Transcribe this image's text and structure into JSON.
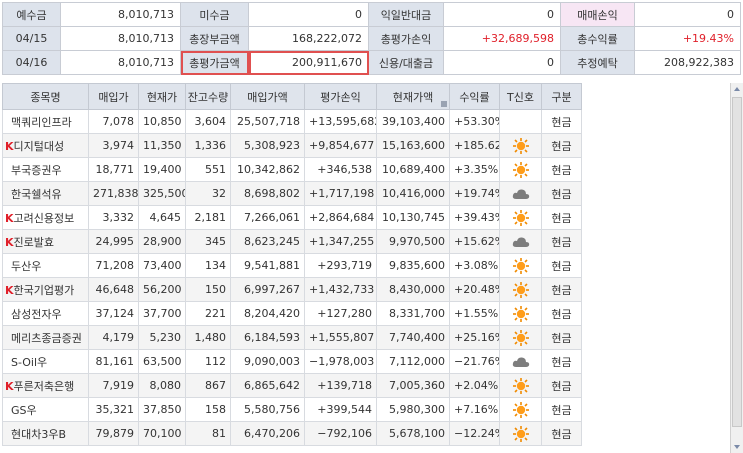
{
  "summary": {
    "row1": {
      "l1": "예수금",
      "v1": "8,010,713",
      "l2": "미수금",
      "v2": "0",
      "l3": "익일반대금",
      "v3": "0",
      "l4": "매매손익",
      "v4": "0"
    },
    "row2": {
      "l1": "04/15",
      "v1": "8,010,713",
      "l2": "총장부금액",
      "v2": "168,222,072",
      "l3": "총평가손익",
      "v3": "+32,689,598",
      "l4": "총수익률",
      "v4": "+19.43%"
    },
    "row3": {
      "l1": "04/16",
      "v1": "8,010,713",
      "l2": "총평가금액",
      "v2": "200,911,670",
      "l3": "신용/대출금",
      "v3": "0",
      "l4": "추정예탁",
      "v4": "208,922,383"
    }
  },
  "columns": [
    "종목명",
    "매입가",
    "현재가",
    "잔고수량",
    "매입가액",
    "평가손익",
    "현재가액",
    "수익률",
    "T신호",
    "구분"
  ],
  "rows": [
    {
      "k": "",
      "name": "맥쿼리인프라",
      "buy": "7,078",
      "cur": "10,850",
      "qty": "3,604",
      "buyamt": "25,507,718",
      "pl": "+13,595,682",
      "curamt": "39,103,400",
      "rate": "+53.30%",
      "signal": "",
      "type": "현금"
    },
    {
      "k": "K",
      "name": "디지털대성",
      "buy": "3,974",
      "cur": "11,350",
      "qty": "1,336",
      "buyamt": "5,308,923",
      "pl": "+9,854,677",
      "curamt": "15,163,600",
      "rate": "+185.62%",
      "signal": "sun",
      "type": "현금"
    },
    {
      "k": "",
      "name": "부국증권우",
      "buy": "18,771",
      "cur": "19,400",
      "qty": "551",
      "buyamt": "10,342,862",
      "pl": "+346,538",
      "curamt": "10,689,400",
      "rate": "+3.35%",
      "signal": "sun",
      "type": "현금"
    },
    {
      "k": "",
      "name": "한국쉘석유",
      "buy": "271,838",
      "cur": "325,500",
      "qty": "32",
      "buyamt": "8,698,802",
      "pl": "+1,717,198",
      "curamt": "10,416,000",
      "rate": "+19.74%",
      "signal": "cloud",
      "type": "현금"
    },
    {
      "k": "K",
      "name": "고려신용정보",
      "buy": "3,332",
      "cur": "4,645",
      "qty": "2,181",
      "buyamt": "7,266,061",
      "pl": "+2,864,684",
      "curamt": "10,130,745",
      "rate": "+39.43%",
      "signal": "sun",
      "type": "현금"
    },
    {
      "k": "K",
      "name": "진로발효",
      "buy": "24,995",
      "cur": "28,900",
      "qty": "345",
      "buyamt": "8,623,245",
      "pl": "+1,347,255",
      "curamt": "9,970,500",
      "rate": "+15.62%",
      "signal": "cloud",
      "type": "현금"
    },
    {
      "k": "",
      "name": "두산우",
      "buy": "71,208",
      "cur": "73,400",
      "qty": "134",
      "buyamt": "9,541,881",
      "pl": "+293,719",
      "curamt": "9,835,600",
      "rate": "+3.08%",
      "signal": "sun",
      "type": "현금"
    },
    {
      "k": "K",
      "name": "한국기업평가",
      "buy": "46,648",
      "cur": "56,200",
      "qty": "150",
      "buyamt": "6,997,267",
      "pl": "+1,432,733",
      "curamt": "8,430,000",
      "rate": "+20.48%",
      "signal": "sun",
      "type": "현금"
    },
    {
      "k": "",
      "name": "삼성전자우",
      "buy": "37,124",
      "cur": "37,700",
      "qty": "221",
      "buyamt": "8,204,420",
      "pl": "+127,280",
      "curamt": "8,331,700",
      "rate": "+1.55%",
      "signal": "sun",
      "type": "현금"
    },
    {
      "k": "",
      "name": "메리츠종금증권",
      "buy": "4,179",
      "cur": "5,230",
      "qty": "1,480",
      "buyamt": "6,184,593",
      "pl": "+1,555,807",
      "curamt": "7,740,400",
      "rate": "+25.16%",
      "signal": "sun",
      "type": "현금"
    },
    {
      "k": "",
      "name": "S-Oil우",
      "buy": "81,161",
      "cur": "63,500",
      "qty": "112",
      "buyamt": "9,090,003",
      "pl": "−1,978,003",
      "curamt": "7,112,000",
      "rate": "−21.76%",
      "signal": "cloud",
      "type": "현금"
    },
    {
      "k": "K",
      "name": "푸른저축은행",
      "buy": "7,919",
      "cur": "8,080",
      "qty": "867",
      "buyamt": "6,865,642",
      "pl": "+139,718",
      "curamt": "7,005,360",
      "rate": "+2.04%",
      "signal": "sun",
      "type": "현금"
    },
    {
      "k": "",
      "name": "GS우",
      "buy": "35,321",
      "cur": "37,850",
      "qty": "158",
      "buyamt": "5,580,756",
      "pl": "+399,544",
      "curamt": "5,980,300",
      "rate": "+7.16%",
      "signal": "sun",
      "type": "현금"
    },
    {
      "k": "",
      "name": "현대차3우B",
      "buy": "79,879",
      "cur": "70,100",
      "qty": "81",
      "buyamt": "6,470,206",
      "pl": "−792,106",
      "curamt": "5,678,100",
      "rate": "−12.24%",
      "signal": "sun",
      "type": "현금"
    }
  ],
  "colors": {
    "positive": "#e0202a",
    "negative": "#2f55d4",
    "header_bg": "#dfe4ec",
    "highlight_box": "#e05050"
  }
}
